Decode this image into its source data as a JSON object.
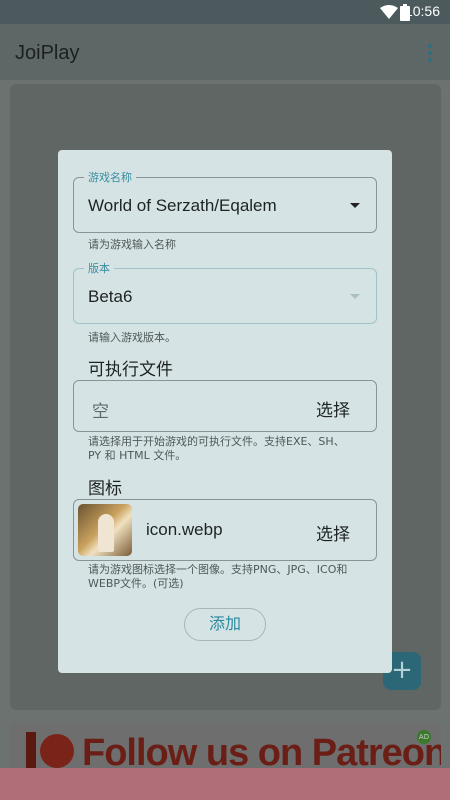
{
  "status_bar": {
    "time": "10:56"
  },
  "app_bar": {
    "title": "JoiPlay"
  },
  "dialog": {
    "name_field": {
      "label": "游戏名称",
      "value": "World of Serzath/Eqalem",
      "helper": "请为游戏输入名称"
    },
    "version_field": {
      "label": "版本",
      "value": "Beta6",
      "helper": "请输入游戏版本。"
    },
    "executable": {
      "title": "可执行文件",
      "value": "空",
      "button": "选择",
      "helper_line1": "请选择用于开始游戏的可执行文件。支持EXE、SH、",
      "helper_line2": "PY 和 HTML 文件。"
    },
    "icon": {
      "title": "图标",
      "file_name": "icon.webp",
      "button": "选择",
      "helper_line1": "请为游戏图标选择一个图像。支持PNG、JPG、ICO和",
      "helper_line2": "WEBP文件。(可选)"
    },
    "add_button": "添加"
  },
  "fab": {
    "label": "+"
  },
  "ad": {
    "text": "Follow us on Patreon",
    "badge": "AD"
  },
  "colors": {
    "accent": "#2a8aa0",
    "dialog_bg": "#d6e3e4",
    "patreon": "#6a1e16"
  }
}
